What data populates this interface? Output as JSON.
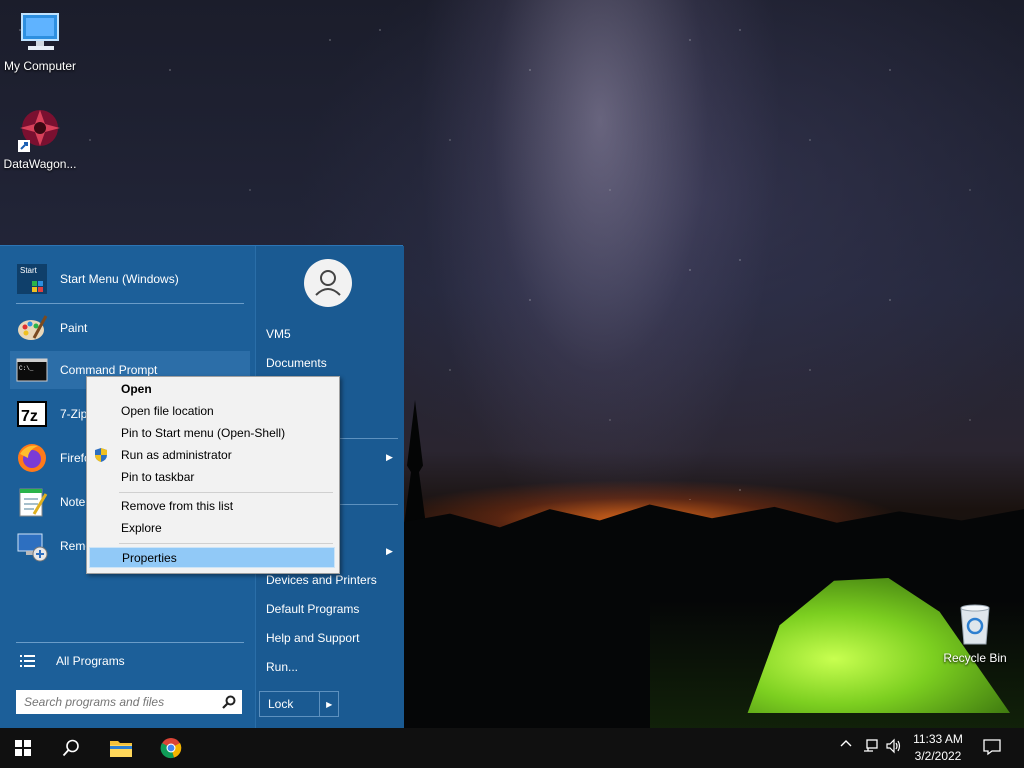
{
  "desktop": {
    "icons": [
      {
        "label": "My Computer"
      },
      {
        "label": "DataWagon..."
      },
      {
        "label": "Recycle Bin"
      }
    ]
  },
  "start_menu": {
    "programs": [
      {
        "label": "Start Menu (Windows)",
        "icon": "start-menu-icon"
      },
      {
        "label": "Paint",
        "icon": "paint-icon"
      },
      {
        "label": "Command Prompt",
        "icon": "cmd-icon"
      },
      {
        "label": "7-Zip",
        "icon": "7zip-icon"
      },
      {
        "label": "Firefox",
        "icon": "firefox-icon"
      },
      {
        "label": "Notepad",
        "icon": "notepad-icon"
      },
      {
        "label": "Remote Desktop Connection",
        "icon": "remote-desktop-icon"
      }
    ],
    "all_programs": "All Programs",
    "search_placeholder": "Search programs and files",
    "right": {
      "user": "VM5",
      "documents": "Documents",
      "devices_printers": "Devices and Printers",
      "default_programs": "Default Programs",
      "help_support": "Help and Support",
      "run": "Run...",
      "lock": "Lock"
    }
  },
  "context_menu": {
    "items": [
      {
        "label": "Open"
      },
      {
        "label": "Open file location"
      },
      {
        "label": "Pin to Start menu (Open-Shell)"
      },
      {
        "label": "Run as administrator"
      },
      {
        "label": "Pin to taskbar"
      },
      {
        "label": "Remove from this list"
      },
      {
        "label": "Explore"
      },
      {
        "label": "Properties"
      }
    ]
  },
  "taskbar": {
    "time": "11:33 AM",
    "date": "3/2/2022"
  }
}
